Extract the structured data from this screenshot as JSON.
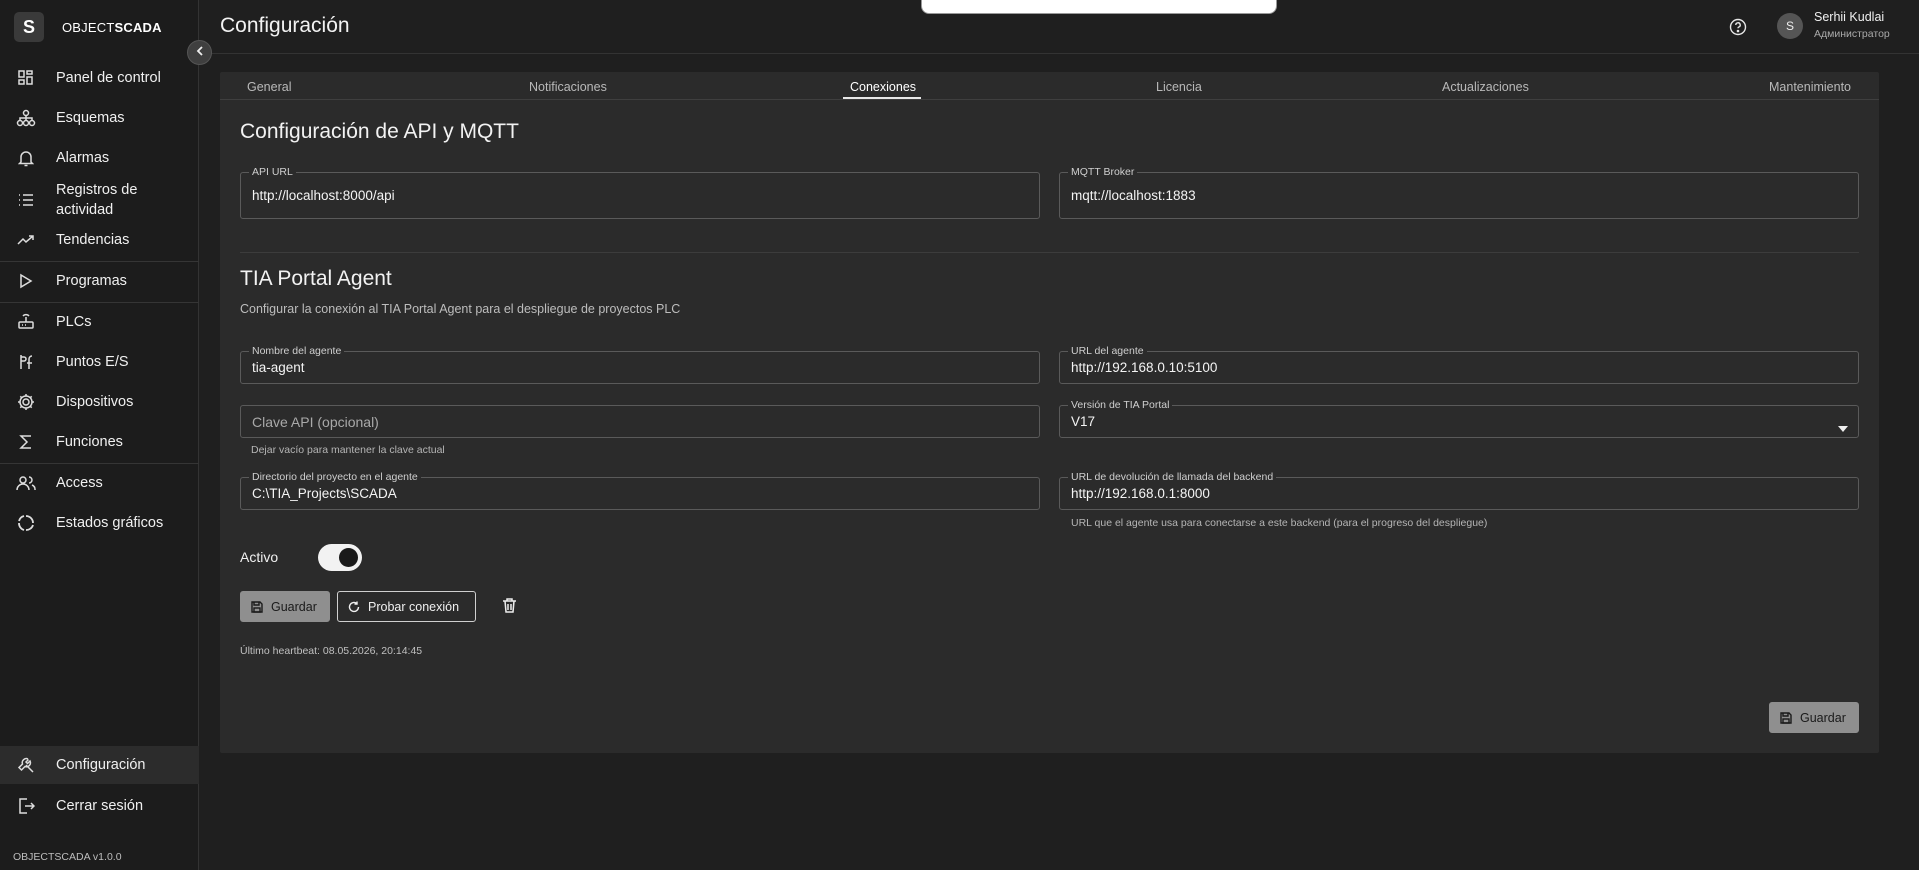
{
  "app": {
    "logo_letter": "S",
    "logo_text_light": "OBJECT",
    "logo_text_bold": "SCADA",
    "version": "OBJECTSCADA v1.0.0"
  },
  "sidebar": {
    "items": [
      {
        "label": "Panel de control",
        "icon": "dashboard-icon"
      },
      {
        "label": "Esquemas",
        "icon": "schema-icon"
      },
      {
        "label": "Alarmas",
        "icon": "bell-icon"
      },
      {
        "label": "Registros de\nactividad",
        "icon": "list-icon"
      },
      {
        "label": "Tendencias",
        "icon": "trend-icon"
      },
      {
        "label": "Programas",
        "icon": "play-icon"
      },
      {
        "label": "PLCs",
        "icon": "router-icon"
      },
      {
        "label": "Puntos E/S",
        "icon": "io-points-icon"
      },
      {
        "label": "Dispositivos",
        "icon": "gear-icon"
      },
      {
        "label": "Funciones",
        "icon": "sigma-icon"
      },
      {
        "label": "Access",
        "icon": "users-icon"
      },
      {
        "label": "Estados gráficos",
        "icon": "circle-states-icon"
      }
    ],
    "bottom": [
      {
        "label": "Configuración",
        "icon": "wrench-icon"
      },
      {
        "label": "Cerrar sesión",
        "icon": "logout-icon"
      }
    ]
  },
  "header": {
    "title": "Configuración",
    "user_initial": "S",
    "user_name": "Serhii Kudlai",
    "user_role": "Администратор"
  },
  "tabs": [
    "General",
    "Notificaciones",
    "Conexiones",
    "Licencia",
    "Actualizaciones",
    "Mantenimiento"
  ],
  "active_tab": "Conexiones",
  "api_section": {
    "title": "Configuración de API y MQTT",
    "api_url_label": "API URL",
    "api_url_value": "http://localhost:8000/api",
    "mqtt_label": "MQTT Broker",
    "mqtt_value": "mqtt://localhost:1883"
  },
  "tia_section": {
    "title": "TIA Portal Agent",
    "description": "Configurar la conexión al TIA Portal Agent para el despliegue de proyectos PLC",
    "agent_name_label": "Nombre del agente",
    "agent_name_value": "tia-agent",
    "agent_url_label": "URL del agente",
    "agent_url_value": "http://192.168.0.10:5100",
    "api_key_placeholder": "Clave API (opcional)",
    "api_key_helper": "Dejar vacío para mantener la clave actual",
    "tia_version_label": "Versión de TIA Portal",
    "tia_version_value": "V17",
    "project_dir_label": "Directorio del proyecto en el agente",
    "project_dir_value": "C:\\TIA_Projects\\SCADA",
    "callback_label": "URL de devolución de llamada del backend",
    "callback_value": "http://192.168.0.1:8000",
    "callback_helper": "URL que el agente usa para conectarse a este backend (para el progreso del despliegue)",
    "active_label": "Activo",
    "active_on": true,
    "save_label": "Guardar",
    "test_label": "Probar conexión",
    "heartbeat": "Último heartbeat: 08.05.2026, 20:14:45"
  },
  "footer_save_label": "Guardar"
}
